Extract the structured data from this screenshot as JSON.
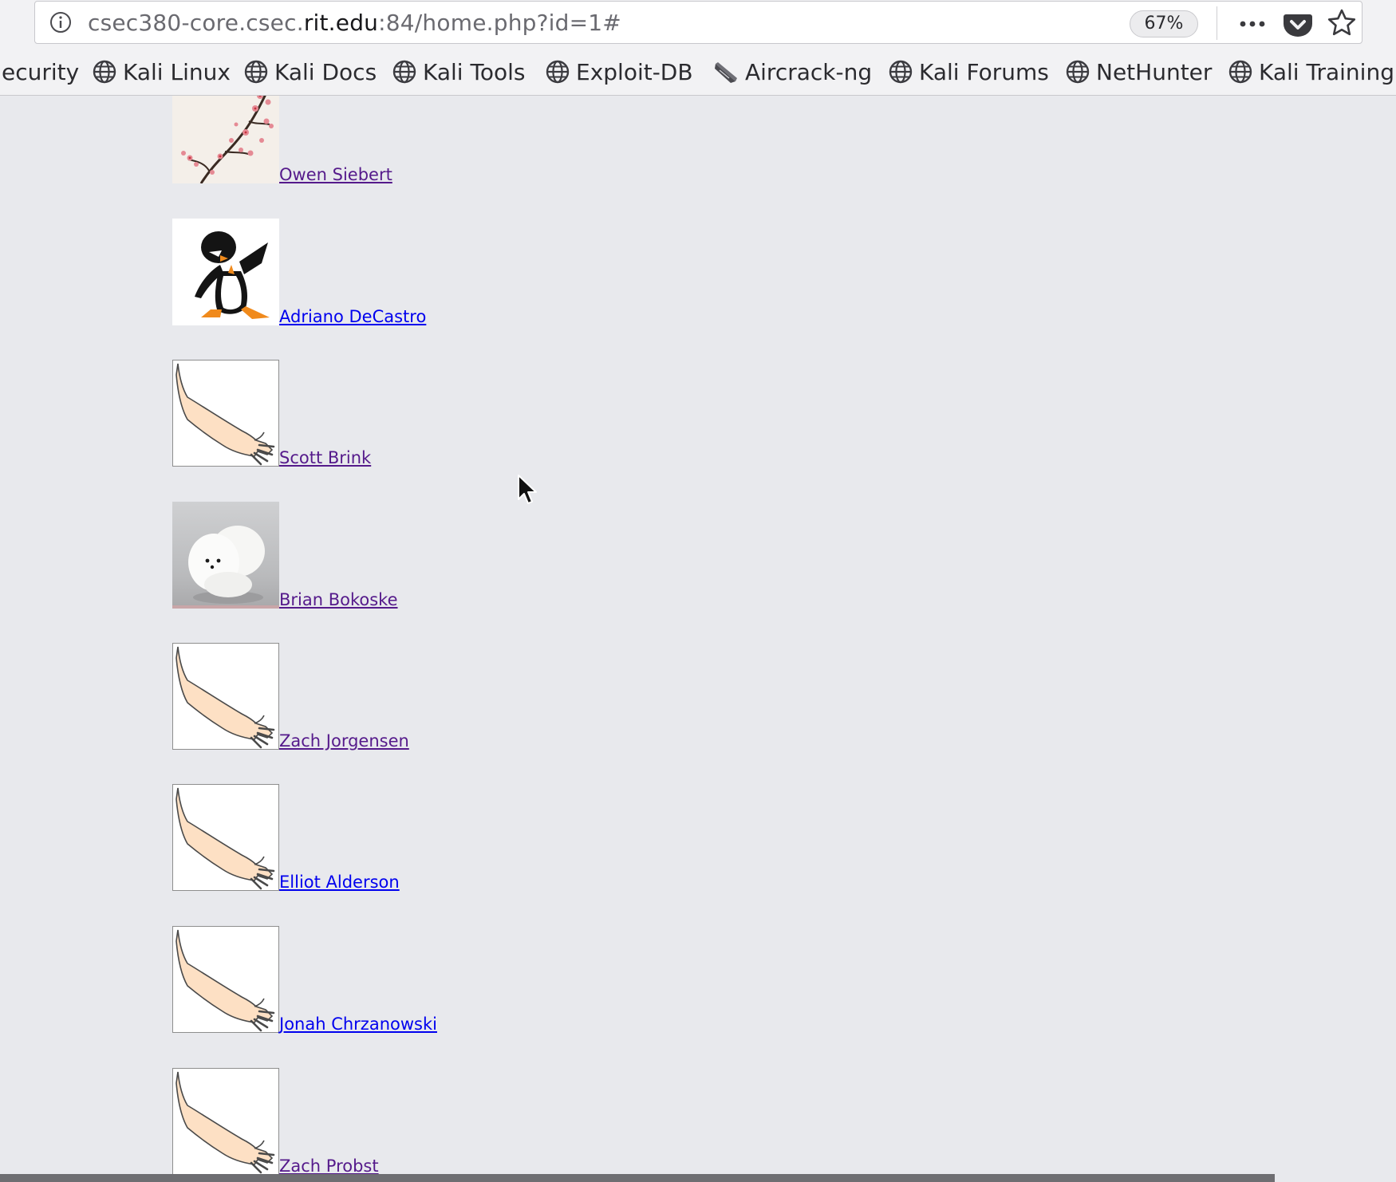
{
  "browser": {
    "url": {
      "prefix": "csec380-core.csec.",
      "domain": "rit.edu",
      "suffix": ":84/home.php?id=1#"
    },
    "zoom_label": "67%"
  },
  "bookmarks": [
    {
      "label": "ecurity",
      "icon": "none"
    },
    {
      "label": "Kali Linux",
      "icon": "globe-icon"
    },
    {
      "label": "Kali Docs",
      "icon": "globe-icon"
    },
    {
      "label": "Kali Tools",
      "icon": "globe-icon"
    },
    {
      "label": "Exploit-DB",
      "icon": "globe-icon"
    },
    {
      "label": "Aircrack-ng",
      "icon": "aircrack-icon"
    },
    {
      "label": "Kali Forums",
      "icon": "globe-icon"
    },
    {
      "label": "NetHunter",
      "icon": "globe-icon"
    },
    {
      "label": "Kali Training",
      "icon": "globe-icon"
    }
  ],
  "users": [
    {
      "name": "Owen Siebert",
      "avatar": "cherry-blossom",
      "visited": true
    },
    {
      "name": "Adriano DeCastro",
      "avatar": "dabbing-penguin",
      "visited": false
    },
    {
      "name": "Scott Brink",
      "avatar": "arm-drawing",
      "visited": true
    },
    {
      "name": "Brian Bokoske",
      "avatar": "white-pomeranian",
      "visited": true
    },
    {
      "name": "Zach Jorgensen",
      "avatar": "arm-drawing",
      "visited": true
    },
    {
      "name": "Elliot Alderson",
      "avatar": "arm-drawing",
      "visited": false
    },
    {
      "name": "Jonah Chrzanowski",
      "avatar": "arm-drawing",
      "visited": false
    },
    {
      "name": "Zach Probst",
      "avatar": "arm-drawing",
      "visited": true
    }
  ],
  "colors": {
    "link_visited": "#551a8b",
    "link_unvisited": "#0000ee",
    "page_background": "#e8e9ed"
  }
}
